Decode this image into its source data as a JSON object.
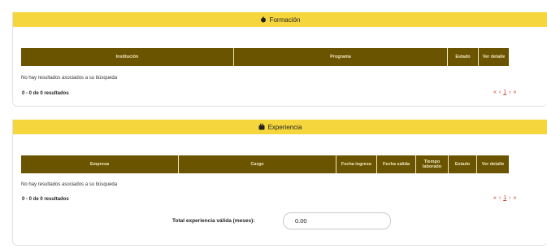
{
  "formacion": {
    "title": "Formación",
    "icon": "graduation-icon",
    "columns": [
      "Institución",
      "Programa",
      "Estado",
      "Ver detalle"
    ],
    "no_results": "No hay resultados asociados a su búsqueda",
    "count": "0 - 0 de 0 resultados",
    "pager": {
      "first": "«",
      "prev": "‹",
      "page": "1",
      "next": "›",
      "last": "»"
    }
  },
  "experiencia": {
    "title": "Experiencia",
    "icon": "briefcase-icon",
    "columns": [
      "Empresa",
      "Cargo",
      "Fecha ingreso",
      "Fecha salida",
      "Tiempo laborado",
      "Estado",
      "Ver detalle"
    ],
    "no_results": "No hay resultados asociados a su búsqueda",
    "count": "0 - 0 de 0 resultados",
    "pager": {
      "first": "«",
      "prev": "‹",
      "page": "1",
      "next": "›",
      "last": "»"
    },
    "total_label": "Total experiencia válida (meses):",
    "total_value": "0.00"
  },
  "colors": {
    "header_yellow": "#f5d63d",
    "grid_header": "#6b5400",
    "pager_red": "#c0392b"
  }
}
